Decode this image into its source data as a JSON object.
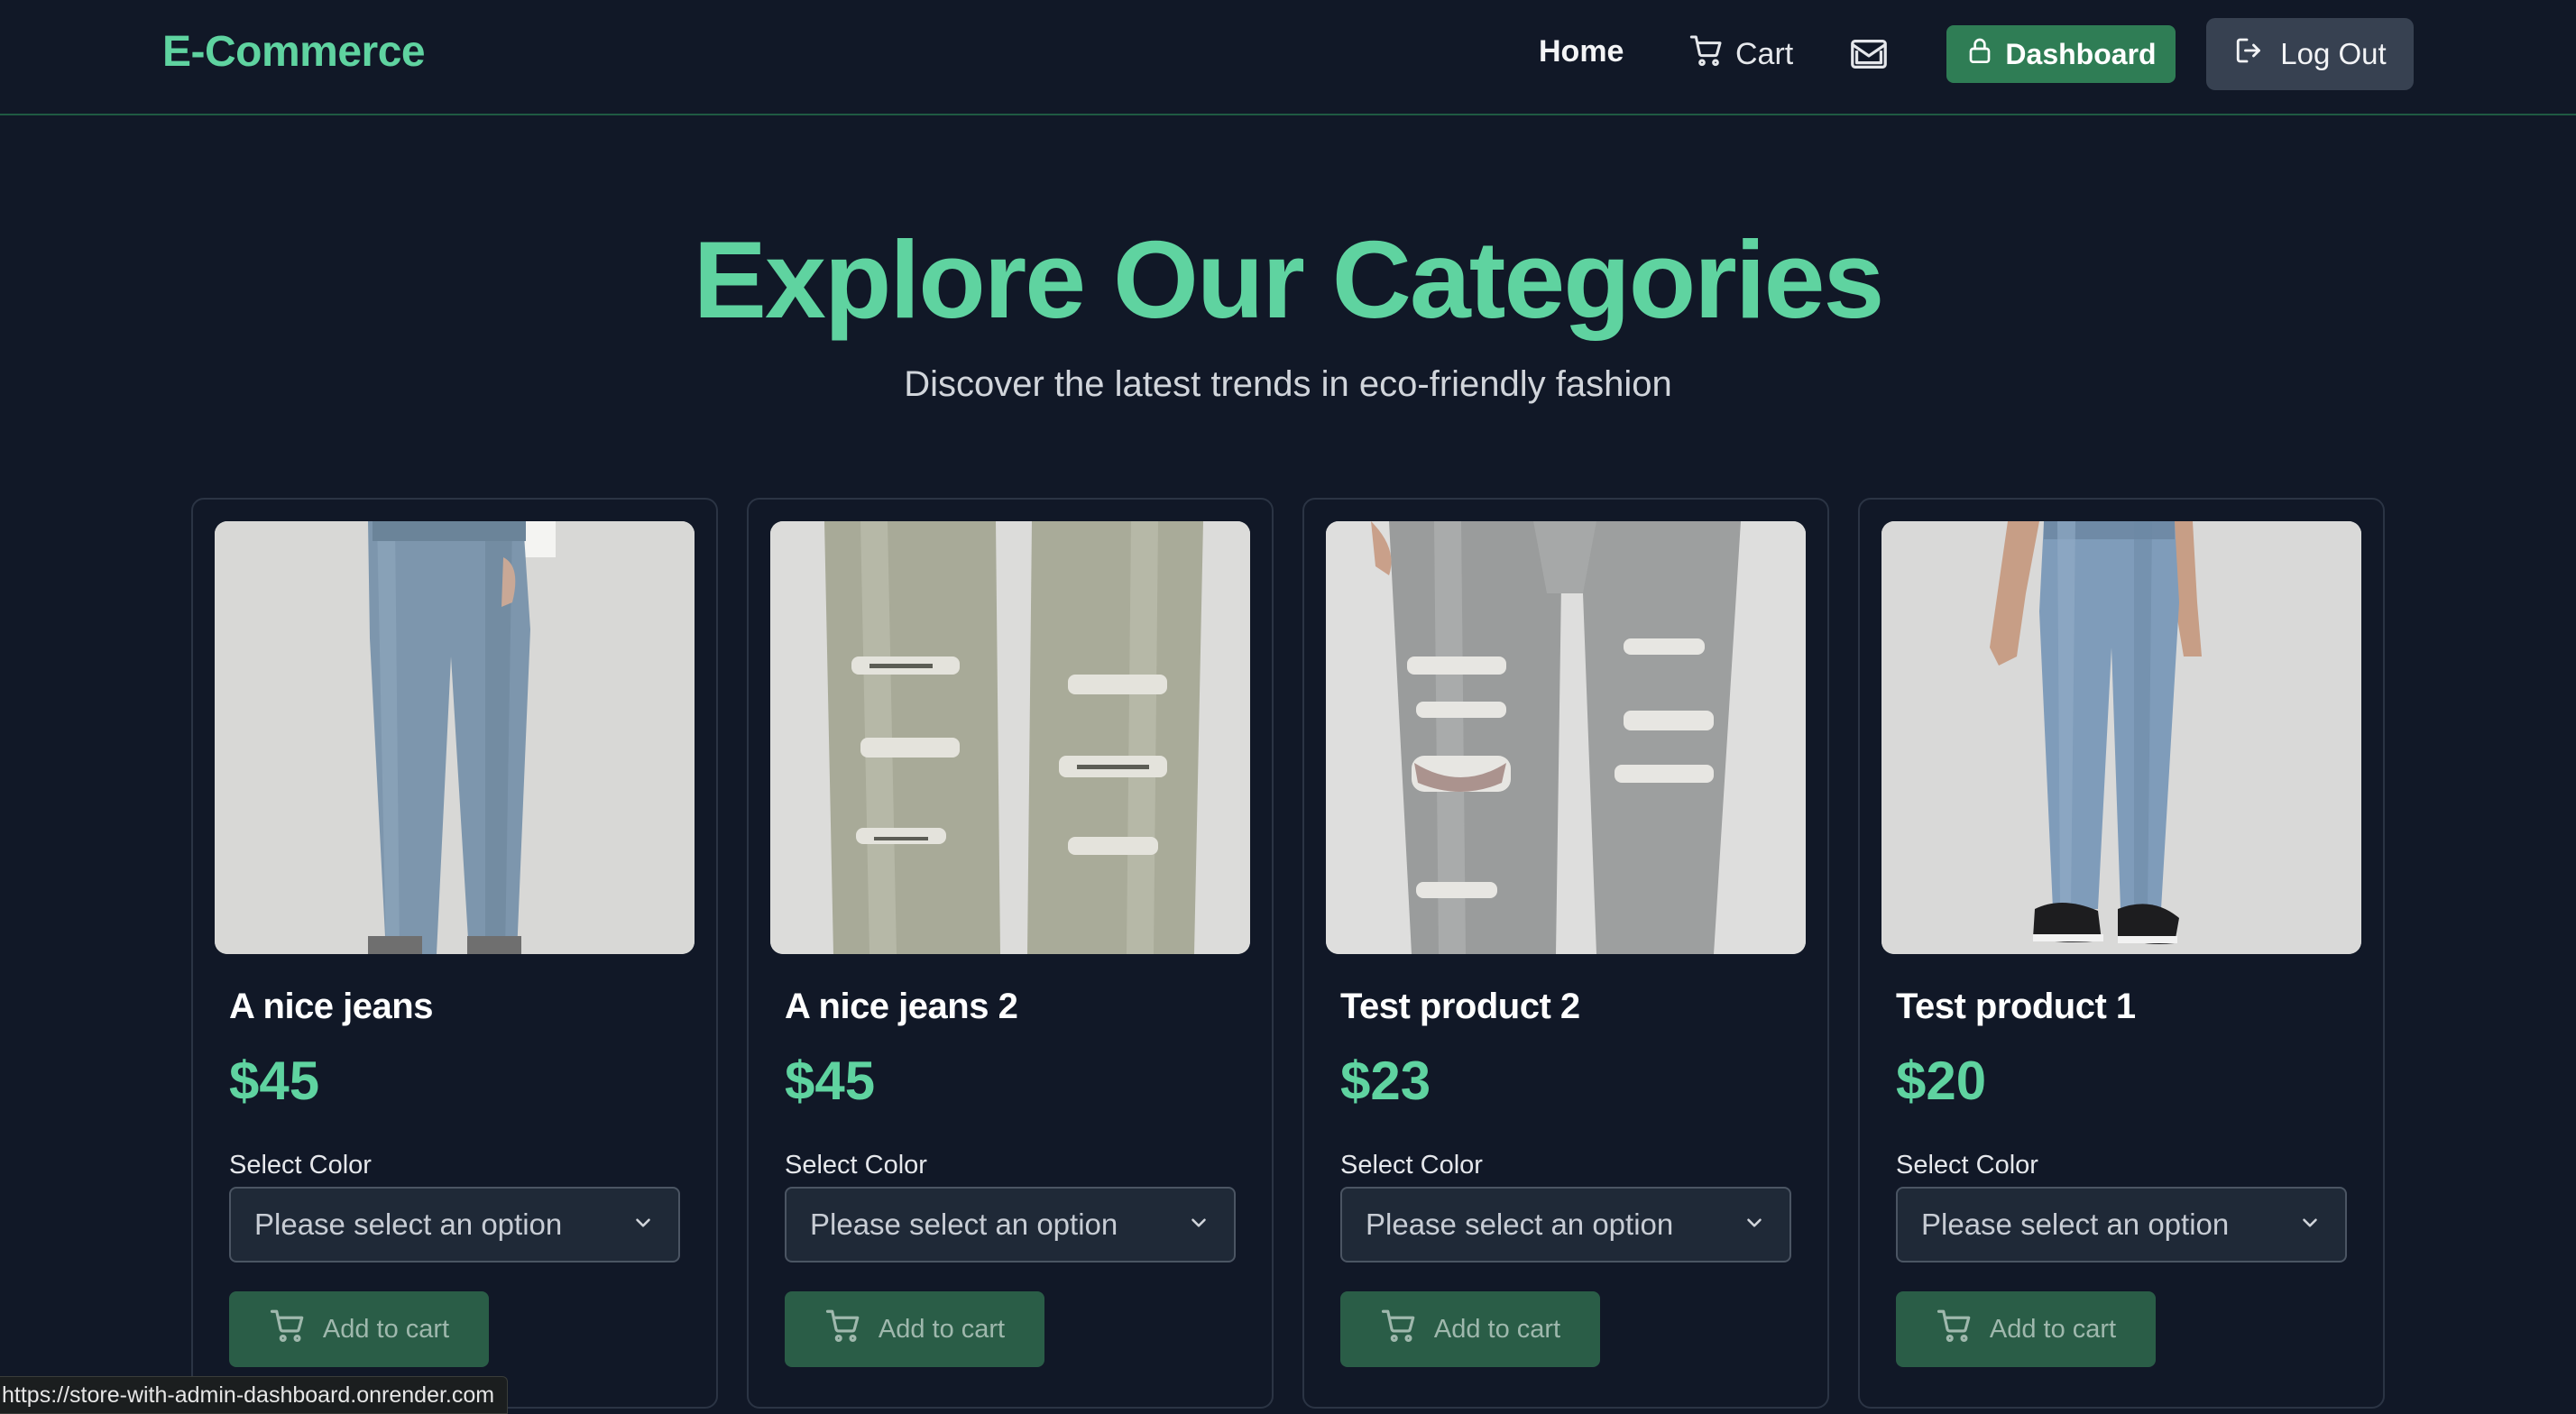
{
  "navbar": {
    "logo": "E-Commerce",
    "home": "Home",
    "cart": "Cart",
    "dashboard": "Dashboard",
    "logout": "Log Out"
  },
  "hero": {
    "title": "Explore Our Categories",
    "subtitle": "Discover the latest trends in eco-friendly fashion"
  },
  "products": [
    {
      "name": "A nice jeans",
      "price": "$45",
      "color_label": "Select Color",
      "color_placeholder": "Please select an option",
      "button": "Add to cart",
      "image_icon": "jeans-image-light-blue"
    },
    {
      "name": "A nice jeans 2",
      "price": "$45",
      "color_label": "Select Color",
      "color_placeholder": "Please select an option",
      "button": "Add to cart",
      "image_icon": "jeans-image-ripped-grey"
    },
    {
      "name": "Test product 2",
      "price": "$23",
      "color_label": "Select Color",
      "color_placeholder": "Please select an option",
      "button": "Add to cart",
      "image_icon": "jeans-image-ripped-grey"
    },
    {
      "name": "Test product 1",
      "price": "$20",
      "color_label": "Select Color",
      "color_placeholder": "Please select an option",
      "button": "Add to cart",
      "image_icon": "jeans-image-blue-sneakers"
    }
  ],
  "status_bar": {
    "url": "https://store-with-admin-dashboard.onrender.com"
  },
  "colors": {
    "background": "#111827",
    "accent": "#5fd3a0",
    "dashboard_button": "#2f7d55",
    "add_to_cart_button": "#2a5d47"
  }
}
